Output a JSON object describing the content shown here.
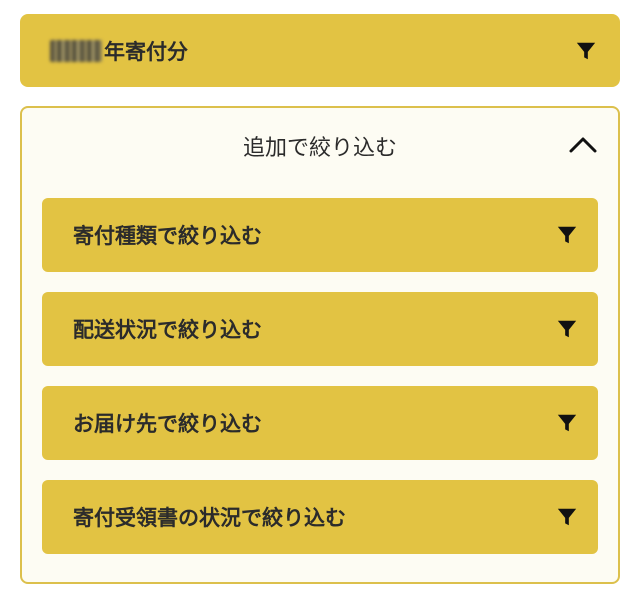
{
  "year_filter": {
    "label_suffix": "年寄付分",
    "icon": "filter-icon"
  },
  "additional_filter": {
    "title": "追加で絞り込む",
    "toggle_icon": "chevron-up-icon",
    "items": [
      {
        "label": "寄付種類で絞り込む",
        "icon": "filter-icon"
      },
      {
        "label": "配送状況で絞り込む",
        "icon": "filter-icon"
      },
      {
        "label": "お届け先で絞り込む",
        "icon": "filter-icon"
      },
      {
        "label": "寄付受領書の状況で絞り込む",
        "icon": "filter-icon"
      }
    ]
  },
  "colors": {
    "button_bg": "#e2c343",
    "panel_bg": "#fdfcf3",
    "panel_border": "#dcc04c",
    "text": "#2b2b2b",
    "icon": "#111111"
  }
}
